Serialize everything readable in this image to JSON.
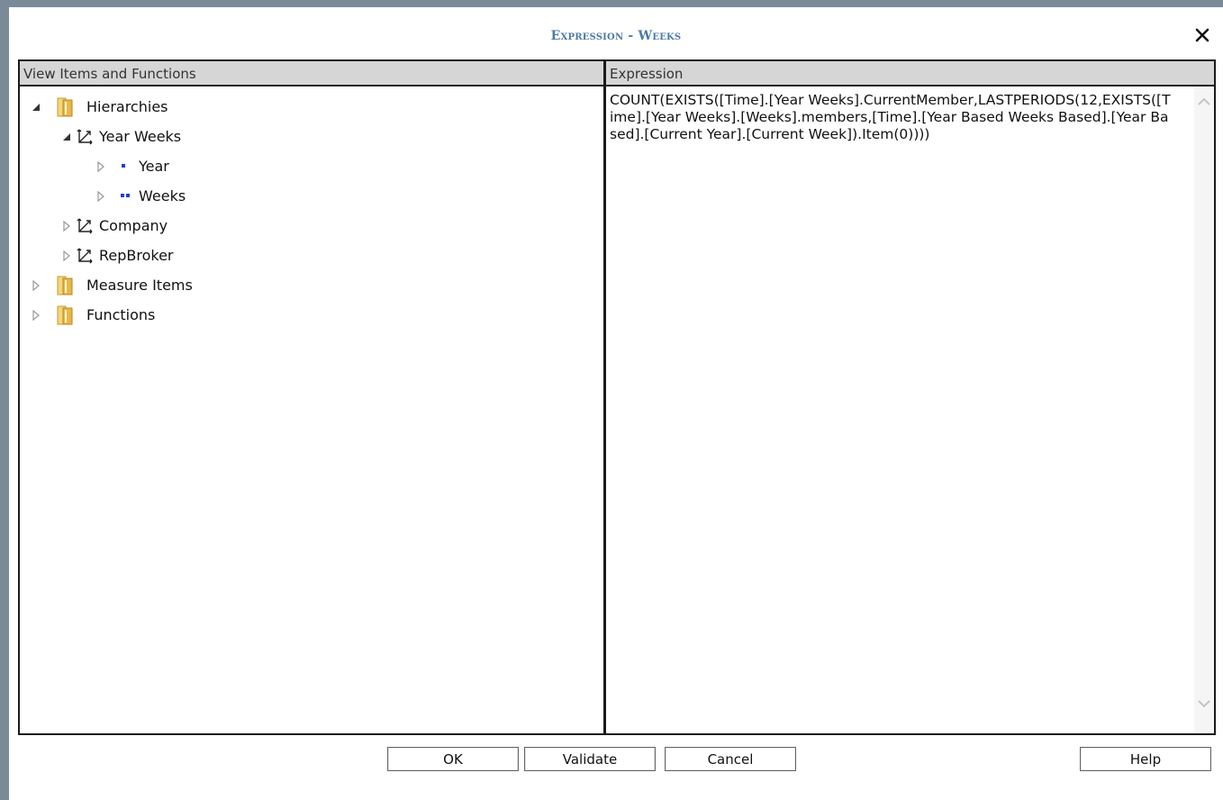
{
  "dialog": {
    "title": "Expression - Weeks",
    "close_label": "×"
  },
  "left_pane": {
    "header": "View Items and Functions",
    "tree": {
      "hierarchies": "Hierarchies",
      "year_weeks": "Year Weeks",
      "year": "Year",
      "weeks": "Weeks",
      "company": "Company",
      "repbroker": "RepBroker",
      "measure_items": "Measure Items",
      "functions": "Functions"
    }
  },
  "right_pane": {
    "header": "Expression",
    "expression": "COUNT(EXISTS([Time].[Year Weeks].CurrentMember,LASTPERIODS(12,EXISTS([Time].[Year Weeks].[Weeks].members,[Time].[Year Based Weeks Based].[Year Based].[Current Year].[Current Week]).Item(0))))"
  },
  "buttons": {
    "ok": "OK",
    "validate": "Validate",
    "cancel": "Cancel",
    "help": "Help"
  },
  "colors": {
    "title": "#4d7aa6",
    "header_bg": "#d6d6d6",
    "level_icon": "#1f3fd1",
    "folder": "#e6b84a"
  }
}
